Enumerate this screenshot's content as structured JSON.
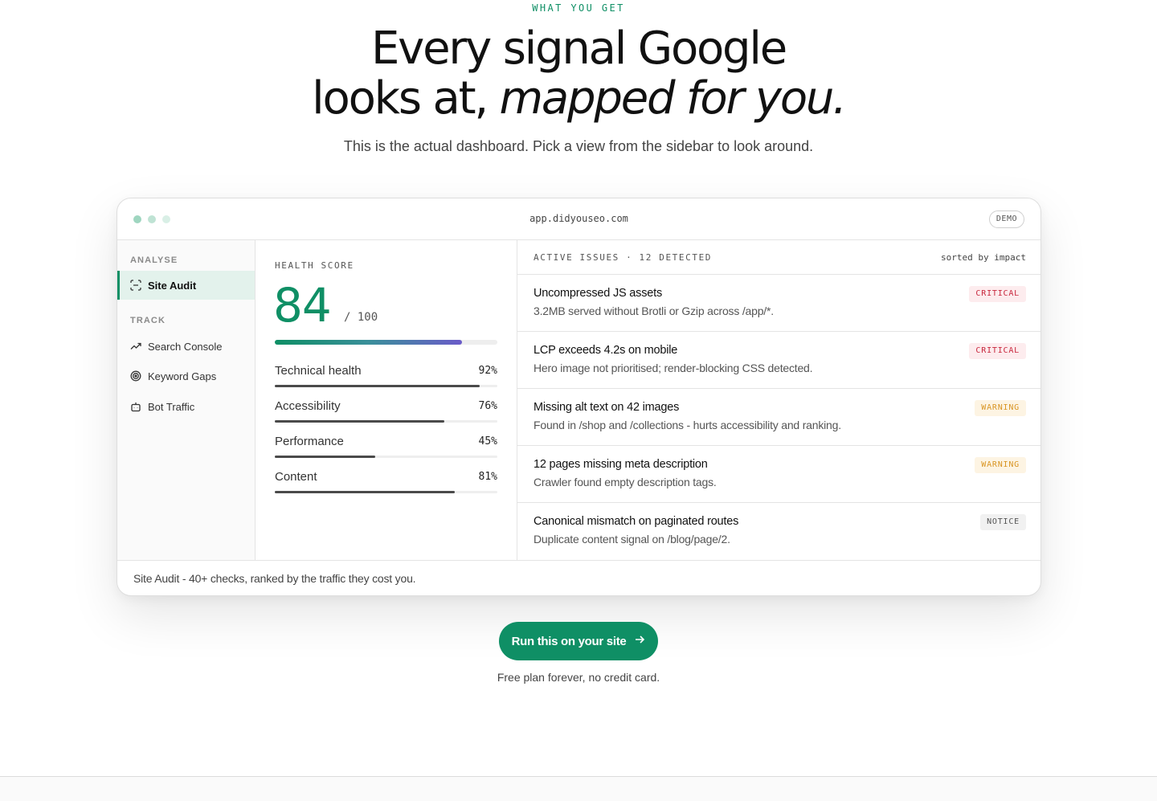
{
  "hero": {
    "eyebrow": "WHAT YOU GET",
    "headline_line1": "Every signal Google",
    "headline_line2_plain": "looks at, ",
    "headline_line2_italic": "mapped for you.",
    "subline": "This is the actual dashboard. Pick a view from the sidebar to look around."
  },
  "window": {
    "url": "app.didyouseo.com",
    "badge": "DEMO"
  },
  "sidebar": {
    "section_analyse": "ANALYSE",
    "section_track": "TRACK",
    "items": [
      {
        "label": "Site Audit",
        "icon": "scan-icon",
        "active": true
      },
      {
        "label": "Search Console",
        "icon": "trend-up-icon",
        "active": false
      },
      {
        "label": "Keyword Gaps",
        "icon": "target-icon",
        "active": false
      },
      {
        "label": "Bot Traffic",
        "icon": "bot-icon",
        "active": false
      }
    ]
  },
  "health": {
    "label": "HEALTH SCORE",
    "score": "84",
    "score_max": "/ 100",
    "score_fraction": 0.84,
    "metrics": [
      {
        "name": "Technical health",
        "value": "92%",
        "fraction": 0.92
      },
      {
        "name": "Accessibility",
        "value": "76%",
        "fraction": 0.76
      },
      {
        "name": "Performance",
        "value": "45%",
        "fraction": 0.45
      },
      {
        "name": "Content",
        "value": "81%",
        "fraction": 0.81
      }
    ]
  },
  "issues": {
    "title": "ACTIVE ISSUES · 12 DETECTED",
    "sort": "sorted by impact",
    "items": [
      {
        "title": "Uncompressed JS assets",
        "desc": "3.2MB served without Brotli or Gzip across /app/*.",
        "severity": "CRITICAL"
      },
      {
        "title": "LCP exceeds 4.2s on mobile",
        "desc": "Hero image not prioritised; render-blocking CSS detected.",
        "severity": "CRITICAL"
      },
      {
        "title": "Missing alt text on 42 images",
        "desc": "Found in /shop and /collections - hurts accessibility and ranking.",
        "severity": "WARNING"
      },
      {
        "title": "12 pages missing meta description",
        "desc": "Crawler found empty description tags.",
        "severity": "WARNING"
      },
      {
        "title": "Canonical mismatch on paginated routes",
        "desc": "Duplicate content signal on /blog/page/2.",
        "severity": "NOTICE"
      }
    ]
  },
  "footer": {
    "caption": "Site Audit - 40+ checks, ranked by the traffic they cost you."
  },
  "cta": {
    "label": "Run this on your site",
    "note": "Free plan forever, no credit card."
  },
  "colors": {
    "accent": "#0f8f65",
    "critical": "#c8273d",
    "warning": "#d99523",
    "notice": "#555555"
  }
}
